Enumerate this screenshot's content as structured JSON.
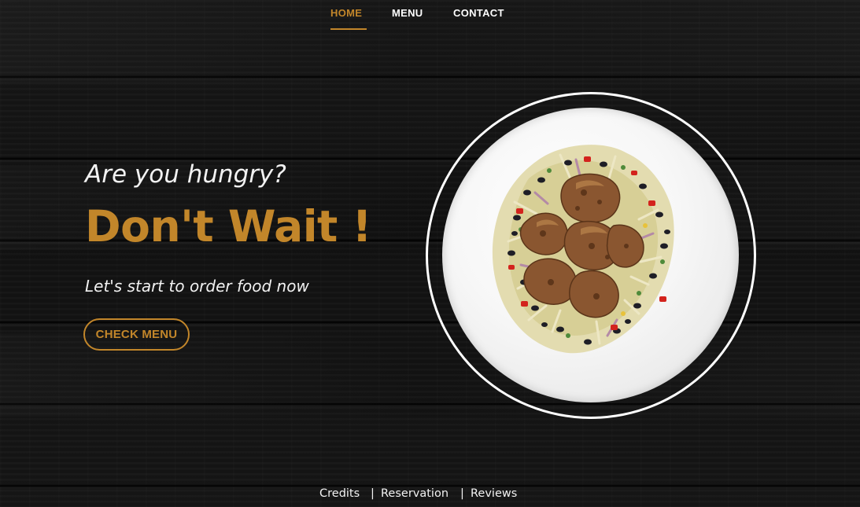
{
  "nav": {
    "items": [
      {
        "label": "HOME",
        "active": true
      },
      {
        "label": "MENU",
        "active": false
      },
      {
        "label": "CONTACT",
        "active": false
      }
    ]
  },
  "hero": {
    "subtitle": "Are you hungry?",
    "title": "Don't Wait !",
    "tagline": "Let's start to order food now",
    "button_label": "CHECK MENU"
  },
  "plate": {
    "icon": "grilled-chicken-salad-plate"
  },
  "footer": {
    "links": [
      "Credits",
      "Reservation",
      "Reviews"
    ],
    "separator": "|"
  },
  "colors": {
    "accent": "#c2862a",
    "text": "#ffffff",
    "background": "#141414"
  }
}
